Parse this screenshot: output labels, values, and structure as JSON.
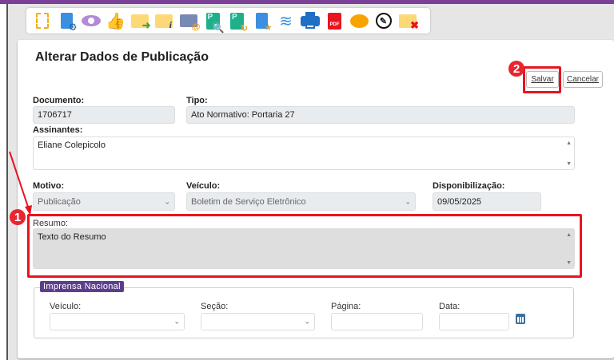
{
  "toolbar": {
    "icons": [
      "new-document-icon",
      "document-settings-icon",
      "view-icon",
      "like-icon",
      "move-folder-icon",
      "folder-info-icon",
      "email-icon",
      "search-publication-icon",
      "republish-icon",
      "favorite-document-icon",
      "layers-icon",
      "print-icon",
      "pdf-icon",
      "comment-icon",
      "sign-icon",
      "close-folder-icon"
    ],
    "pdf_label": "PDF"
  },
  "page": {
    "title": "Alterar Dados de Publicação"
  },
  "actions": {
    "save_label": "Salvar",
    "cancel_label": "Cancelar"
  },
  "form": {
    "documento": {
      "label": "Documento:",
      "value": "1706717"
    },
    "tipo": {
      "label": "Tipo:",
      "value": "Ato Normativo: Portaria 27"
    },
    "assinantes": {
      "label": "Assinantes:",
      "value": "Eliane Colepicolo"
    },
    "motivo": {
      "label": "Motivo:",
      "value": "Publicação"
    },
    "veiculo": {
      "label": "Veículo:",
      "value": "Boletim de Serviço Eletrônico"
    },
    "disponibilizacao": {
      "label": "Disponibilização:",
      "value": "09/05/2025"
    },
    "resumo": {
      "label": "Resumo:",
      "value": "Texto do Resumo"
    }
  },
  "imprensa": {
    "legend": "Imprensa Nacional",
    "veiculo_label": "Veículo:",
    "secao_label": "Seção:",
    "pagina_label": "Página:",
    "data_label": "Data:"
  },
  "annotations": {
    "badge1": "1",
    "badge2": "2",
    "color": "#e8141e"
  }
}
